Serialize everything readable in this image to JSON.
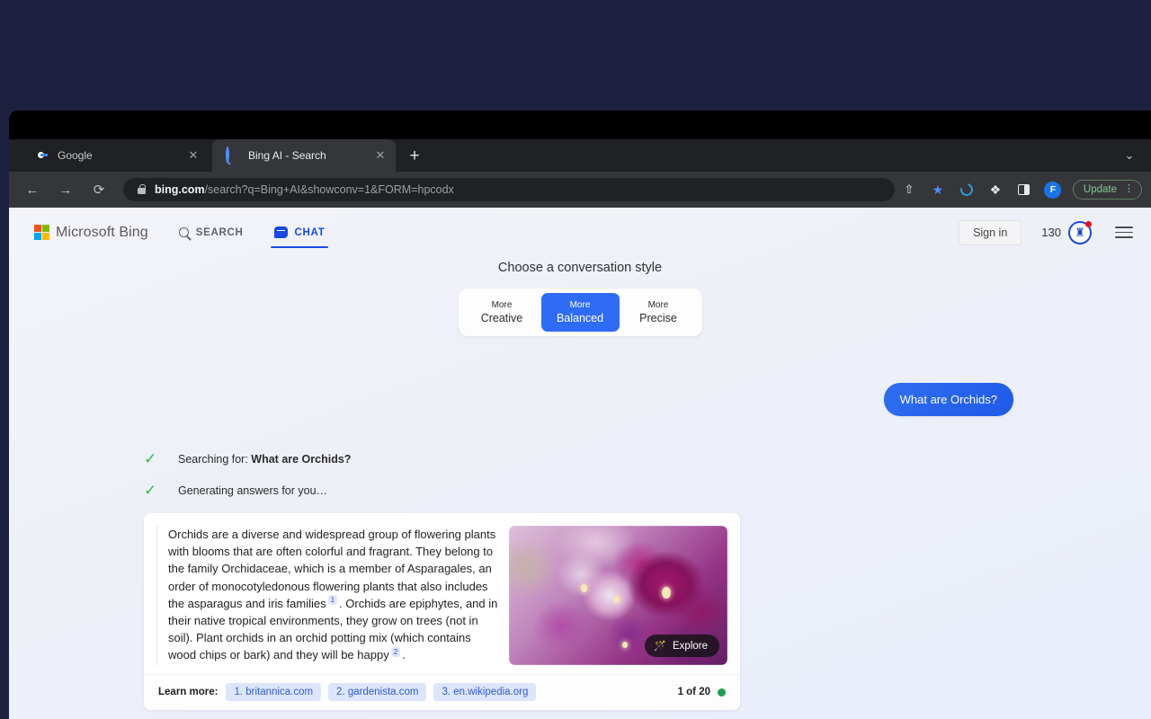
{
  "browser": {
    "tabs": [
      {
        "title": "Google",
        "favicon": "google-icon",
        "active": false,
        "close_label": "✕"
      },
      {
        "title": "Bing AI - Search",
        "favicon": "bing-search-icon",
        "active": true,
        "close_label": "✕"
      }
    ],
    "new_tab_label": "+",
    "tab_list_chevron": "⌄",
    "nav": {
      "back": "←",
      "forward": "→",
      "reload": "⟳"
    },
    "url": {
      "host": "bing.com",
      "path": "/search?q=Bing+AI&showconv=1&FORM=hpcodx"
    },
    "toolbar_icons": {
      "share": "⇧",
      "bookmark": "★",
      "refresh_extension": "refresh-icon",
      "extensions": "❖",
      "side_panel": "side-panel-icon",
      "profile_initial": "F"
    },
    "update_label": "Update",
    "update_menu": "⋮"
  },
  "bing": {
    "logo_text": "Microsoft Bing",
    "nav": [
      {
        "label": "SEARCH",
        "icon": "search-icon",
        "active": false
      },
      {
        "label": "CHAT",
        "icon": "chat-bubble-icon",
        "active": true
      }
    ],
    "sign_in_label": "Sign in",
    "rewards_count": "130",
    "rewards_icon": "♜",
    "menu_icon": "hamburger-icon"
  },
  "conversation_style": {
    "title": "Choose a conversation style",
    "options": [
      {
        "line1": "More",
        "line2": "Creative",
        "selected": false
      },
      {
        "line1": "More",
        "line2": "Balanced",
        "selected": true
      },
      {
        "line1": "More",
        "line2": "Precise",
        "selected": false
      }
    ],
    "selected_color": "#2f6cf6"
  },
  "chat": {
    "user_message": "What are Orchids?",
    "status": [
      {
        "check": "✓",
        "prefix": "Searching for: ",
        "query": "What are Orchids?"
      },
      {
        "check": "✓",
        "prefix": "Generating answers for you…",
        "query": ""
      }
    ],
    "answer": {
      "part1": "Orchids are a diverse and widespread group of flowering plants with blooms that are often colorful and fragrant. They belong to the family Orchidaceae, which is a member of Asparagales, an order of monocotyledonous flowering plants that also includes the asparagus and iris families",
      "cite1": "1",
      "part2": ". Orchids are epiphytes, and in their native tropical environments, they grow on trees (not in soil). Plant orchids in an orchid potting mix (which contains wood chips or bark) and they will be happy",
      "cite2": "2",
      "part3": ".",
      "image_alt": "pink orchid flowers",
      "explore_label": "Explore",
      "explore_icon": "🪄"
    },
    "footer": {
      "learn_more_label": "Learn more:",
      "sources": [
        "1. britannica.com",
        "2. gardenista.com",
        "3. en.wikipedia.org"
      ],
      "counter": "1 of 20",
      "counter_dot_color": "#18a04a"
    }
  }
}
